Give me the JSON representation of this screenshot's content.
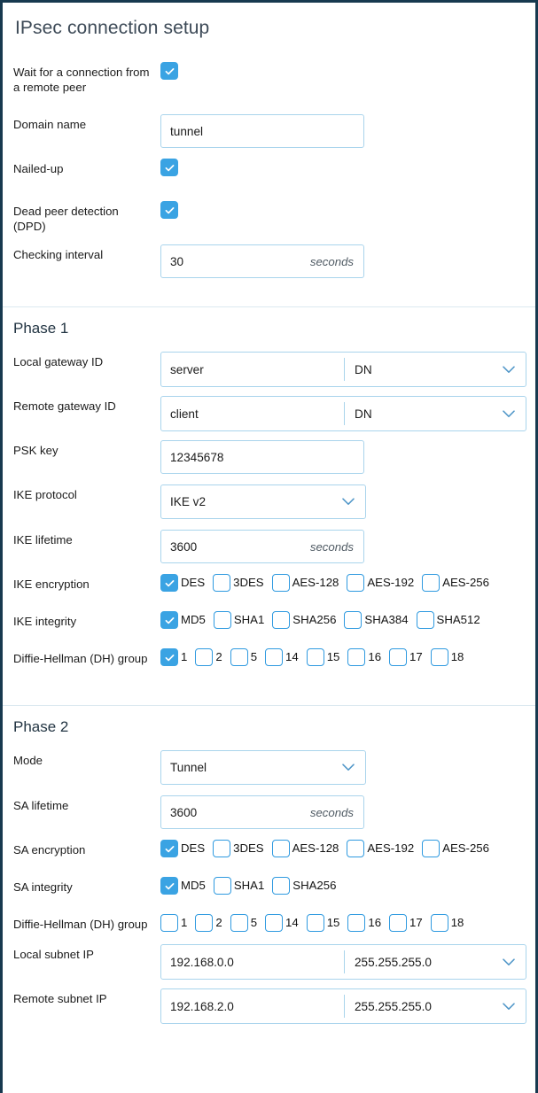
{
  "page": {
    "title": "IPsec connection setup",
    "accent_color": "#3aa3e3",
    "border_color": "#a9d4ec",
    "frame_color": "#17394f",
    "label_color": "#1b1b1b",
    "heading_color": "#233543"
  },
  "general": {
    "wait_for_connection": {
      "label": "Wait for a connection from a remote peer",
      "checked": true
    },
    "domain_name": {
      "label": "Domain name",
      "value": "tunnel"
    },
    "nailed_up": {
      "label": "Nailed-up",
      "checked": true
    },
    "dpd": {
      "label": "Dead peer detection (DPD)",
      "checked": true
    },
    "checking_interval": {
      "label": "Checking interval",
      "value": "30",
      "unit": "seconds"
    }
  },
  "phase1": {
    "heading": "Phase 1",
    "local_gateway_id": {
      "label": "Local gateway ID",
      "value": "server",
      "type": "DN"
    },
    "remote_gateway_id": {
      "label": "Remote gateway ID",
      "value": "client",
      "type": "DN"
    },
    "psk_key": {
      "label": "PSK key",
      "value": "12345678"
    },
    "ike_protocol": {
      "label": "IKE protocol",
      "value": "IKE v2"
    },
    "ike_lifetime": {
      "label": "IKE lifetime",
      "value": "3600",
      "unit": "seconds"
    },
    "ike_encryption": {
      "label": "IKE encryption",
      "options": [
        {
          "label": "DES",
          "checked": true
        },
        {
          "label": "3DES",
          "checked": false
        },
        {
          "label": "AES-128",
          "checked": false
        },
        {
          "label": "AES-192",
          "checked": false
        },
        {
          "label": "AES-256",
          "checked": false
        }
      ]
    },
    "ike_integrity": {
      "label": "IKE integrity",
      "options": [
        {
          "label": "MD5",
          "checked": true
        },
        {
          "label": "SHA1",
          "checked": false
        },
        {
          "label": "SHA256",
          "checked": false
        },
        {
          "label": "SHA384",
          "checked": false
        },
        {
          "label": "SHA512",
          "checked": false
        }
      ]
    },
    "dh_group": {
      "label": "Diffie-Hellman (DH) group",
      "options": [
        {
          "label": "1",
          "checked": true
        },
        {
          "label": "2",
          "checked": false
        },
        {
          "label": "5",
          "checked": false
        },
        {
          "label": "14",
          "checked": false
        },
        {
          "label": "15",
          "checked": false
        },
        {
          "label": "16",
          "checked": false
        },
        {
          "label": "17",
          "checked": false
        },
        {
          "label": "18",
          "checked": false
        }
      ]
    }
  },
  "phase2": {
    "heading": "Phase 2",
    "mode": {
      "label": "Mode",
      "value": "Tunnel"
    },
    "sa_lifetime": {
      "label": "SA lifetime",
      "value": "3600",
      "unit": "seconds"
    },
    "sa_encryption": {
      "label": "SA encryption",
      "options": [
        {
          "label": "DES",
          "checked": true
        },
        {
          "label": "3DES",
          "checked": false
        },
        {
          "label": "AES-128",
          "checked": false
        },
        {
          "label": "AES-192",
          "checked": false
        },
        {
          "label": "AES-256",
          "checked": false
        }
      ]
    },
    "sa_integrity": {
      "label": "SA integrity",
      "options": [
        {
          "label": "MD5",
          "checked": true
        },
        {
          "label": "SHA1",
          "checked": false
        },
        {
          "label": "SHA256",
          "checked": false
        }
      ]
    },
    "dh_group": {
      "label": "Diffie-Hellman (DH) group",
      "options": [
        {
          "label": "1",
          "checked": false
        },
        {
          "label": "2",
          "checked": false
        },
        {
          "label": "5",
          "checked": false
        },
        {
          "label": "14",
          "checked": false
        },
        {
          "label": "15",
          "checked": false
        },
        {
          "label": "16",
          "checked": false
        },
        {
          "label": "17",
          "checked": false
        },
        {
          "label": "18",
          "checked": false
        }
      ]
    },
    "local_subnet_ip": {
      "label": "Local subnet IP",
      "value": "192.168.0.0",
      "mask": "255.255.255.0"
    },
    "remote_subnet_ip": {
      "label": "Remote subnet IP",
      "value": "192.168.2.0",
      "mask": "255.255.255.0"
    }
  }
}
